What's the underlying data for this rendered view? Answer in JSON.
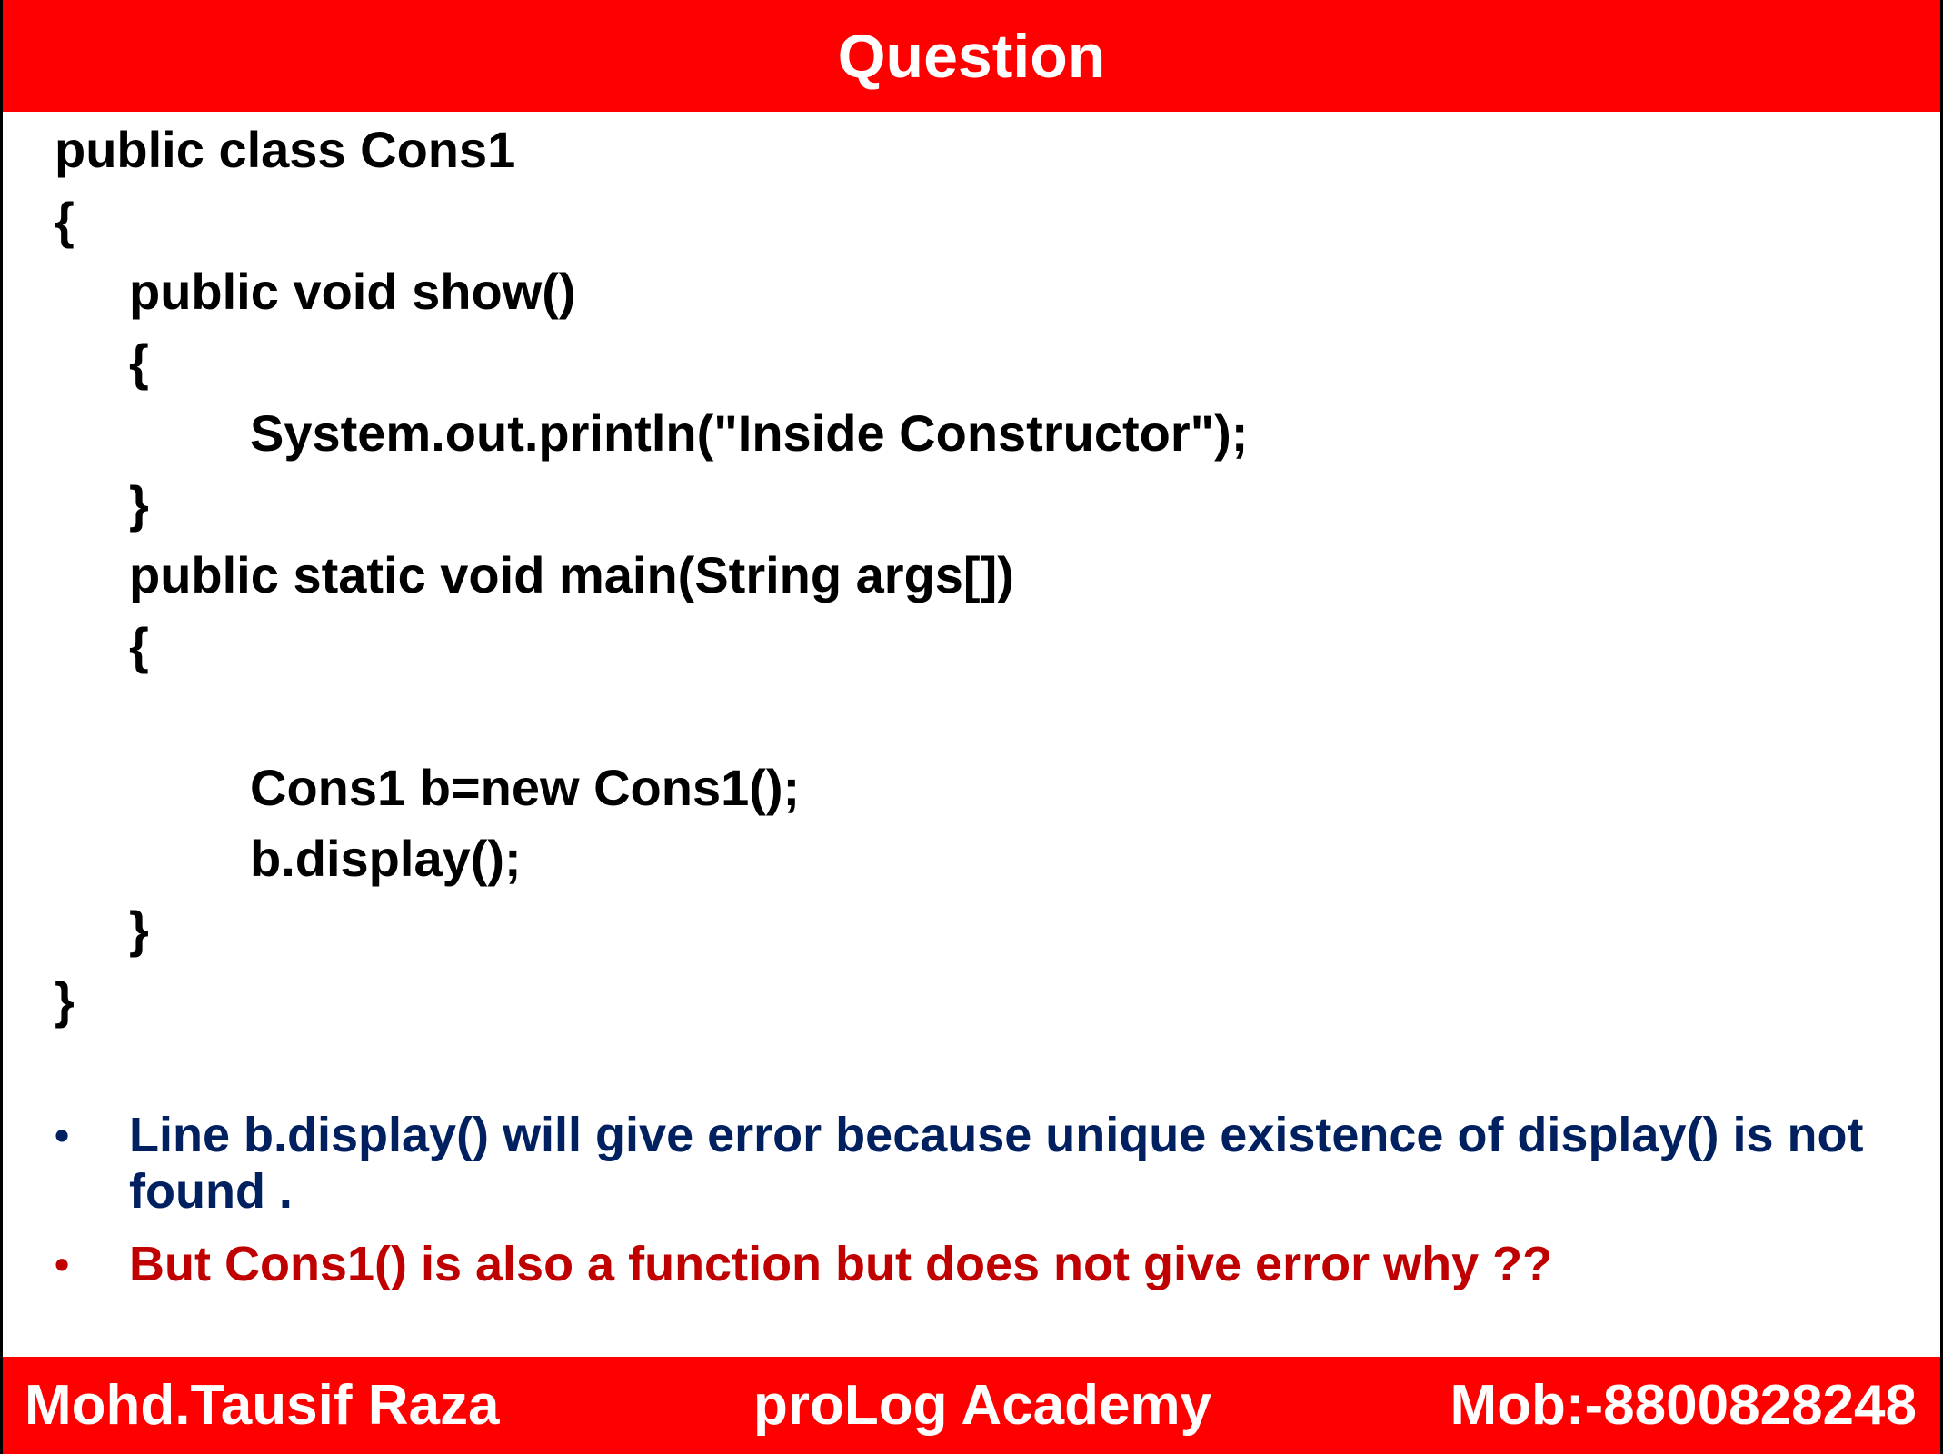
{
  "header": {
    "title": "Question"
  },
  "code": {
    "lines": [
      {
        "text": "public class Cons1",
        "indent": 0
      },
      {
        "text": "{",
        "indent": 0
      },
      {
        "text": "public void show()",
        "indent": 1
      },
      {
        "text": "{",
        "indent": 1
      },
      {
        "text": "System.out.println(\"Inside Constructor\");",
        "indent": 2
      },
      {
        "text": "}",
        "indent": 1
      },
      {
        "text": "public static void main(String args[])",
        "indent": 1
      },
      {
        "text": "{",
        "indent": 1
      },
      {
        "text": "",
        "indent": 0
      },
      {
        "text": "Cons1 b=new Cons1();",
        "indent": 2
      },
      {
        "text": "b.display();",
        "indent": 2
      },
      {
        "text": "}",
        "indent": 1
      },
      {
        "text": "}",
        "indent": 0
      }
    ]
  },
  "bullets": [
    {
      "marker": "•",
      "text": "Line b.display() will give error because unique existence of display() is not found .",
      "color": "#002060"
    },
    {
      "marker": "•",
      "text": "But Cons1() is also a function but does not give error why ??",
      "color": "#c00000"
    }
  ],
  "footer": {
    "author": "Mohd.Tausif Raza",
    "academy": "proLog Academy",
    "mobile": "Mob:-8800828248"
  },
  "colors": {
    "banner": "#ff0000",
    "banner_text": "#ffffff",
    "code_text": "#000000"
  }
}
